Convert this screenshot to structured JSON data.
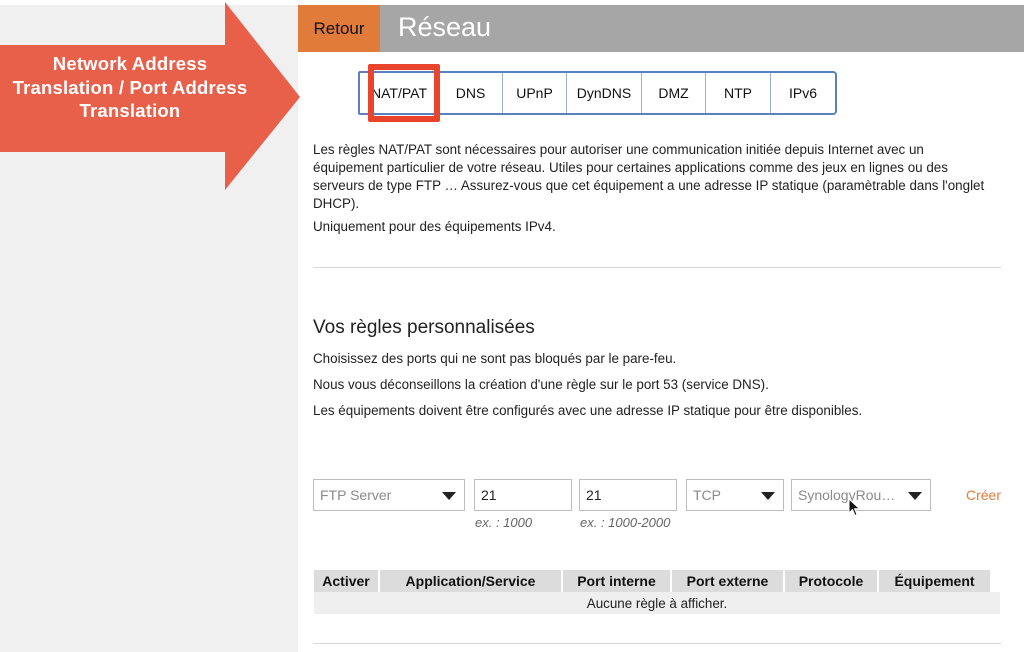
{
  "header": {
    "back_label": "Retour",
    "title": "Réseau"
  },
  "tabs": [
    {
      "label": "NAT/PAT",
      "active": true
    },
    {
      "label": "DNS"
    },
    {
      "label": "UPnP"
    },
    {
      "label": "DynDNS"
    },
    {
      "label": "DMZ"
    },
    {
      "label": "NTP"
    },
    {
      "label": "IPv6"
    }
  ],
  "intro": {
    "paragraph": "Les règles NAT/PAT sont nécessaires pour autoriser une communication initiée depuis Internet avec un équipement particulier de votre réseau. Utiles pour certaines applications comme des jeux en lignes ou des serveurs de type FTP … Assurez-vous que cet équipement a une adresse IP statique (paramètrable dans l'onglet DHCP).",
    "ipv4_note": "Uniquement pour des équipements IPv4."
  },
  "rules": {
    "title": "Vos règles personnalisées",
    "lines": [
      "Choisissez des ports qui ne sont pas bloqués par le pare-feu.",
      "Nous vous déconseillons la création d'une règle sur le port 53 (service DNS).",
      "Les équipements doivent être configurés avec une adresse IP statique pour être disponibles."
    ]
  },
  "form": {
    "service_value": "FTP Server",
    "internal_port_value": "21",
    "internal_port_hint": "ex. : 1000",
    "external_port_value": "21",
    "external_port_hint": "ex. : 1000-2000",
    "protocol_value": "TCP",
    "device_value": "SynologyRou…",
    "create_label": "Créer"
  },
  "table": {
    "columns": [
      "Activer",
      "Application/Service",
      "Port interne",
      "Port externe",
      "Protocole",
      "Équipement"
    ],
    "empty_message": "Aucune règle à afficher."
  },
  "callout": {
    "text": "Network Address Translation / Port Address Translation",
    "color": "#e8604a"
  },
  "colors": {
    "accent": "#e07b39",
    "header": "#a6a6a6",
    "tab_border": "#5b80c0",
    "highlight": "#e8452c"
  }
}
